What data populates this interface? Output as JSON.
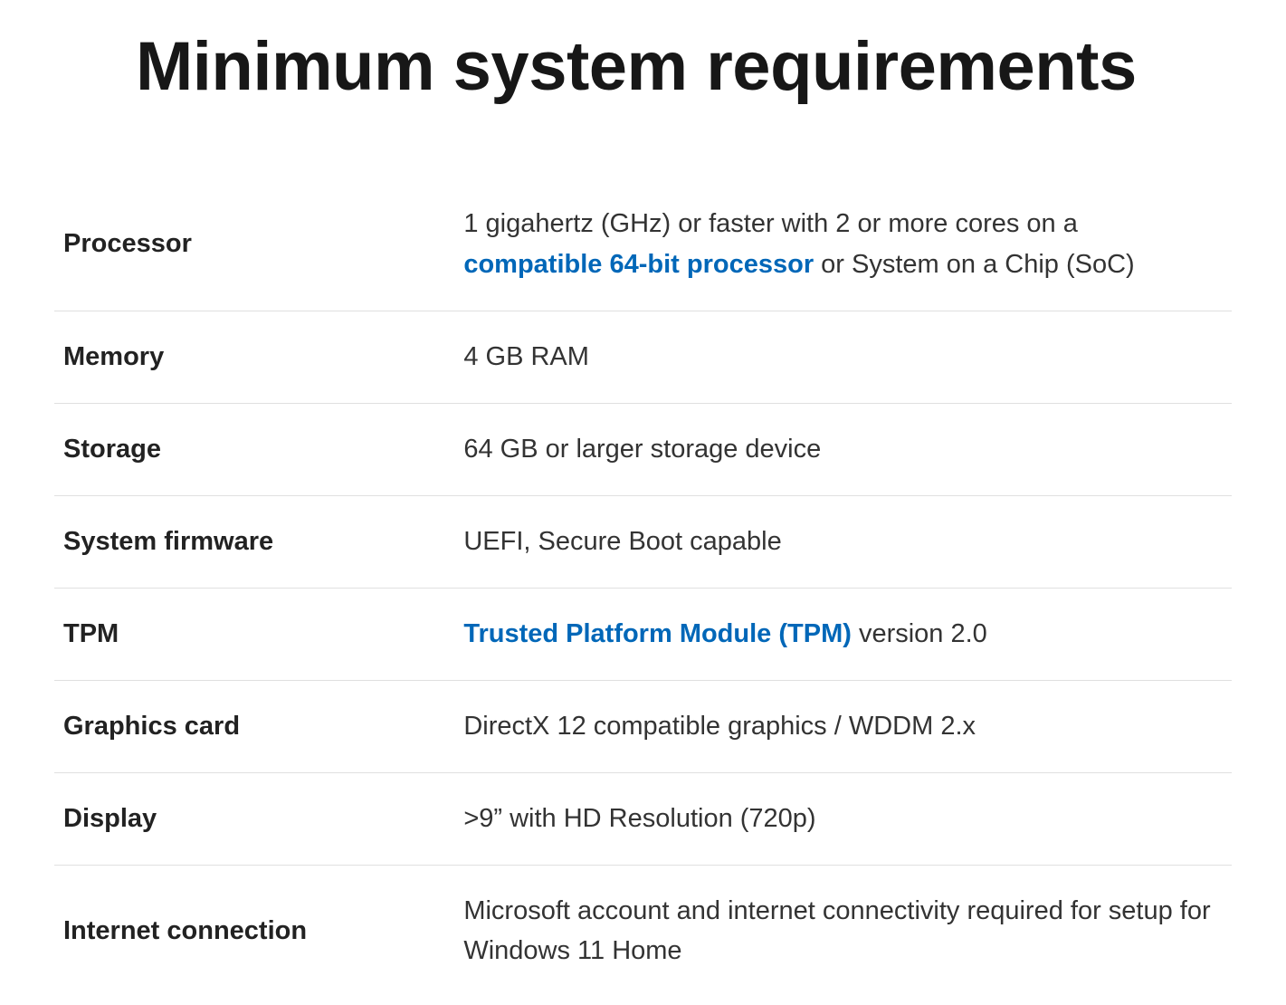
{
  "title": "Minimum system requirements",
  "rows": [
    {
      "label": "Processor",
      "value_pre": "1 gigahertz (GHz) or faster with 2 or more cores on a ",
      "link": "compatible 64-bit processor",
      "value_post": " or System on a Chip (SoC)"
    },
    {
      "label": "Memory",
      "value": "4 GB RAM"
    },
    {
      "label": "Storage",
      "value": "64 GB or larger storage device"
    },
    {
      "label": "System firmware",
      "value": "UEFI, Secure Boot capable"
    },
    {
      "label": "TPM",
      "link": "Trusted Platform Module (TPM)",
      "value_post": " version 2.0"
    },
    {
      "label": "Graphics card",
      "value": "DirectX 12 compatible graphics / WDDM 2.x"
    },
    {
      "label": "Display",
      "value": ">9” with HD Resolution (720p)"
    },
    {
      "label": "Internet connection",
      "value": "Microsoft account and internet connectivity required for setup for Windows 11 Home"
    }
  ]
}
